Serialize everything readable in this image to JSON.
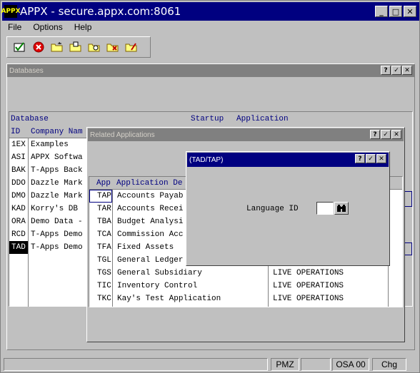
{
  "window": {
    "title": "APPX - secure.appx.com:8061",
    "logo_text": "APPX",
    "minimize": "_",
    "maximize": "□",
    "close": "✕"
  },
  "menu": {
    "items": [
      {
        "label": "File"
      },
      {
        "label": "Options"
      },
      {
        "label": "Help"
      }
    ]
  },
  "toolbar": {
    "icons": [
      "check-icon",
      "cancel-icon",
      "folder-new-icon",
      "folder-open-icon",
      "folder-search-icon",
      "folder-delete-icon",
      "folder-edit-icon"
    ]
  },
  "databases_panel": {
    "title": "Databases",
    "help": "?",
    "ok": "✓",
    "close": "✕",
    "header_database": "Database",
    "header_startup": "Startup",
    "header_application": "Application",
    "col_id": "ID",
    "col_company": "Company Nam",
    "rows": [
      {
        "id": "1EX",
        "company": "Examples"
      },
      {
        "id": "ASI",
        "company": "APPX Softwa"
      },
      {
        "id": "BAK",
        "company": "T-Apps Back"
      },
      {
        "id": "DDO",
        "company": "Dazzle Mark"
      },
      {
        "id": "DMO",
        "company": "Dazzle Mark"
      },
      {
        "id": "KAD",
        "company": "Korry's DB"
      },
      {
        "id": "ORA",
        "company": "Demo Data -"
      },
      {
        "id": "RCD",
        "company": "T-Apps Demo"
      },
      {
        "id": "TAD",
        "company": "T-Apps Demo"
      }
    ]
  },
  "related_panel": {
    "title": "Related Applications",
    "help": "?",
    "ok": "✓",
    "close": "✕",
    "col_app": "App",
    "col_desc": "Application De",
    "rows": [
      {
        "app": "TAP",
        "desc": "Accounts Payab",
        "status": ""
      },
      {
        "app": "TAR",
        "desc": "Accounts Recei",
        "status": ""
      },
      {
        "app": "TBA",
        "desc": "Budget Analysi",
        "status": ""
      },
      {
        "app": "TCA",
        "desc": "Commission Acc",
        "status": ""
      },
      {
        "app": "TFA",
        "desc": "Fixed Assets",
        "status": ""
      },
      {
        "app": "TGL",
        "desc": "General Ledger",
        "status": ""
      },
      {
        "app": "TGS",
        "desc": "General Subsidiary",
        "status": "LIVE OPERATIONS"
      },
      {
        "app": "TIC",
        "desc": "Inventory Control",
        "status": "LIVE OPERATIONS"
      },
      {
        "app": "TKC",
        "desc": "Kay's Test Application",
        "status": "LIVE OPERATIONS"
      }
    ]
  },
  "dialog": {
    "title": "(TAD/TAP)",
    "help": "?",
    "ok": "✓",
    "close": "✕",
    "language_label": "Language ID",
    "language_value": ""
  },
  "status": {
    "cells": [
      "PMZ",
      "OSA 00",
      "Chg"
    ]
  },
  "colors": {
    "titlebar": "#000080",
    "inactive": "#808080",
    "selected": "#000000",
    "header_text": "#000080"
  }
}
